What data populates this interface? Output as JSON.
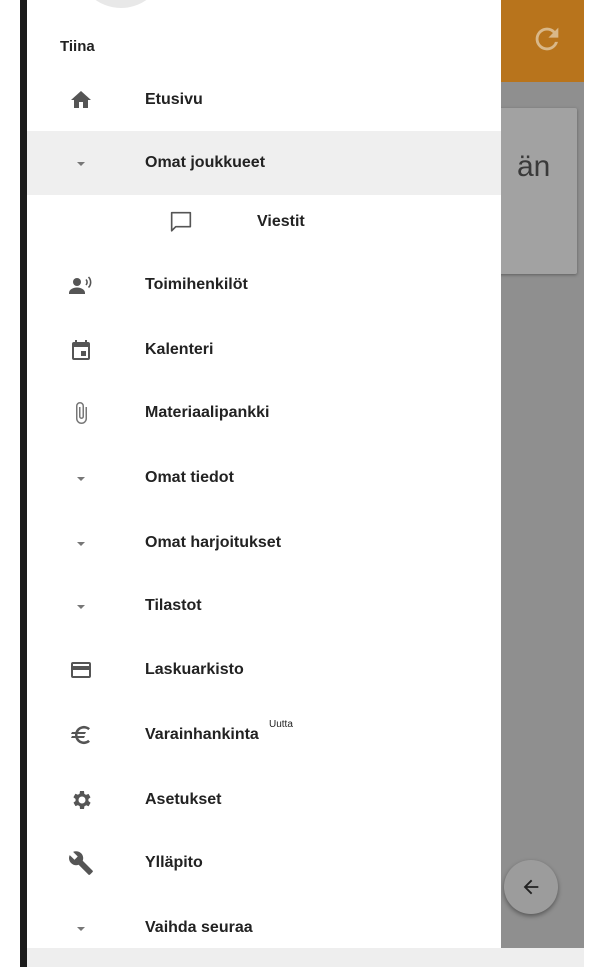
{
  "user": {
    "name": "Tiina"
  },
  "background": {
    "card_text": "än",
    "header_color": "#b8741c"
  },
  "menu": [
    {
      "label": "Etusivu",
      "icon": "home-icon"
    },
    {
      "label": "Omat joukkueet",
      "icon": "caret-down-icon",
      "highlighted": true
    },
    {
      "label": "Viestit",
      "icon": "chat-bubble-icon",
      "sub": true
    },
    {
      "label": "Toimihenkilöt",
      "icon": "record-voice-icon"
    },
    {
      "label": "Kalenteri",
      "icon": "calendar-icon"
    },
    {
      "label": "Materiaalipankki",
      "icon": "paperclip-icon"
    },
    {
      "label": "Omat tiedot",
      "icon": "caret-down-icon"
    },
    {
      "label": "Omat harjoitukset",
      "icon": "caret-down-icon"
    },
    {
      "label": "Tilastot",
      "icon": "caret-down-icon"
    },
    {
      "label": "Laskuarkisto",
      "icon": "credit-card-icon"
    },
    {
      "label": "Varainhankinta",
      "icon": "euro-icon",
      "badge": "Uutta"
    },
    {
      "label": "Asetukset",
      "icon": "gear-icon"
    },
    {
      "label": "Ylläpito",
      "icon": "wrench-icon"
    },
    {
      "label": "Vaihda seuraa",
      "icon": "caret-down-icon"
    }
  ]
}
